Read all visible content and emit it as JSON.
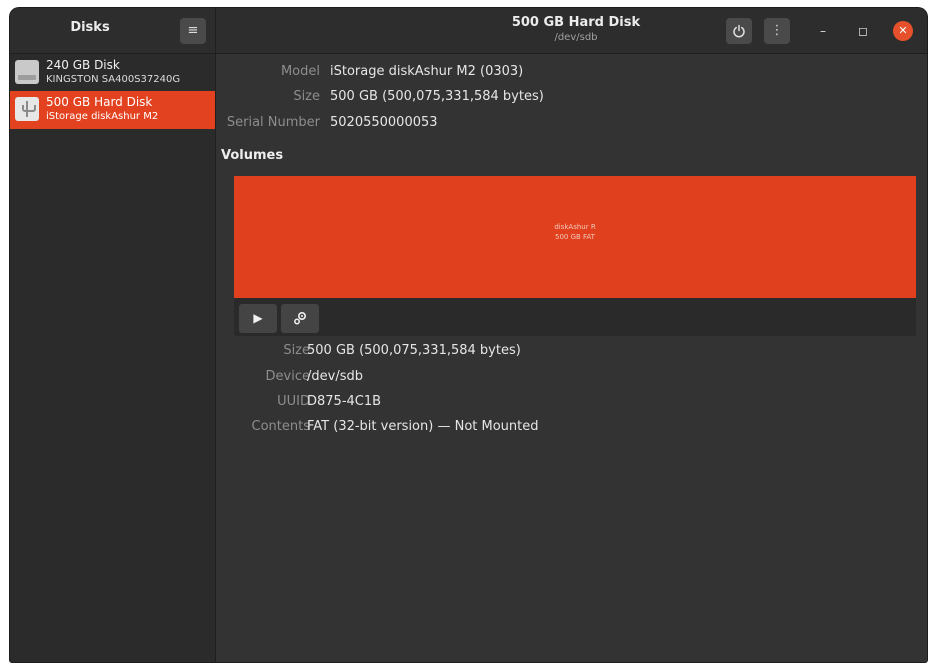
{
  "sidebar": {
    "title": "Disks",
    "menu_icon": "hamburger-menu-icon",
    "disks": [
      {
        "name": "240 GB Disk",
        "model": "KINGSTON SA400S37240G",
        "icon": "hard-disk-icon",
        "selected": false
      },
      {
        "name": "500 GB Hard Disk",
        "model": "iStorage diskAshur M2",
        "icon": "usb-drive-icon",
        "selected": true
      }
    ]
  },
  "header": {
    "title": "500 GB Hard Disk",
    "subtitle": "/dev/sdb",
    "power_icon": "power-icon",
    "more_icon": "more-vertical-icon",
    "minimize_glyph": "–",
    "maximize_glyph": "◻",
    "close_glyph": "✕"
  },
  "drive": {
    "model_label": "Model",
    "model": "iStorage diskAshur M2 (0303)",
    "size_label": "Size",
    "size": "500 GB (500,075,331,584 bytes)",
    "serial_label": "Serial Number",
    "serial": "5020550000053"
  },
  "volumes": {
    "heading": "Volumes",
    "partition": {
      "line1": "diskAshur R",
      "line2": "500 GB FAT"
    },
    "toolbar": {
      "play_glyph": "▶",
      "settings_icon": "gears-icon"
    }
  },
  "volume_details": {
    "size_label": "Size",
    "size": "500 GB (500,075,331,584 bytes)",
    "device_label": "Device",
    "device": "/dev/sdb",
    "uuid_label": "UUID",
    "uuid": "D875-4C1B",
    "contents_label": "Contents",
    "contents": "FAT (32-bit version) — Not Mounted"
  },
  "colors": {
    "accent": "#e2421f",
    "window_bg": "#333333",
    "sidebar_bg": "#2b2b2b"
  }
}
